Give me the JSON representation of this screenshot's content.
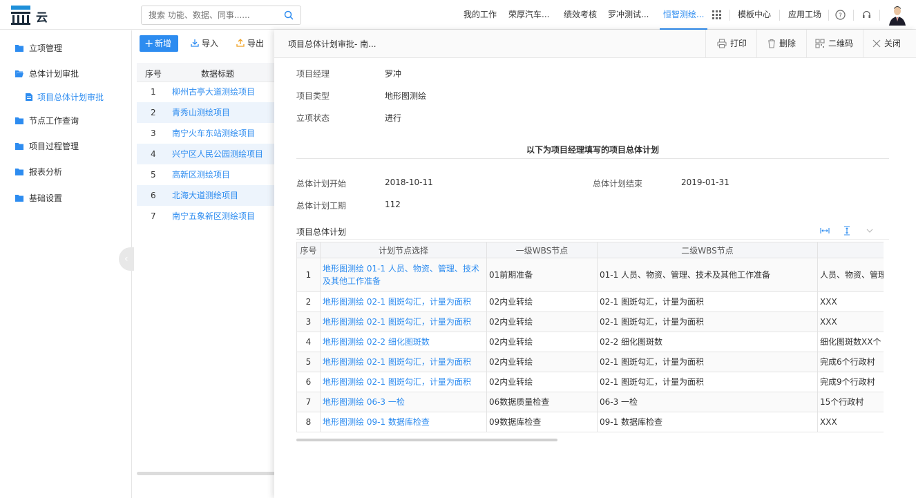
{
  "app": {
    "logo_text": "云"
  },
  "search": {
    "placeholder": "搜索 功能、数据、同事......"
  },
  "topnav": {
    "items": [
      "我的工作",
      "荣厚汽车...",
      "绩效考核",
      "罗冲测试...",
      "恒智测绘...",
      "模板中心",
      "应用工场"
    ]
  },
  "sidebar": {
    "items": [
      "立项管理",
      "总体计划审批",
      "项目总体计划审批",
      "节点工作查询",
      "项目过程管理",
      "报表分析",
      "基础设置"
    ]
  },
  "toolbar": {
    "add": "新增",
    "import": "导入",
    "export": "导出"
  },
  "list": {
    "headers": [
      "序号",
      "数据标题"
    ],
    "rows": [
      {
        "idx": "1",
        "title": "柳州古亭大道测绘项目"
      },
      {
        "idx": "2",
        "title": "青秀山测绘项目"
      },
      {
        "idx": "3",
        "title": "南宁火车东站测绘项目"
      },
      {
        "idx": "4",
        "title": "兴宁区人民公园测绘项目"
      },
      {
        "idx": "5",
        "title": "高新区测绘项目"
      },
      {
        "idx": "6",
        "title": "北海大道测绘项目"
      },
      {
        "idx": "7",
        "title": "南宁五象新区测绘项目"
      }
    ]
  },
  "panel": {
    "title": "项目总体计划审批- 南...",
    "buttons": {
      "print": "打印",
      "delete": "删除",
      "qrcode": "二维码",
      "close": "关闭"
    },
    "fields": {
      "manager_label": "项目经理",
      "manager_value": "罗冲",
      "type_label": "项目类型",
      "type_value": "地形图测绘",
      "status_label": "立项状态",
      "status_value": "进行"
    },
    "section_title": "以下为项目经理填写的项目总体计划",
    "plan": {
      "start_label": "总体计划开始",
      "start_value": "2018-10-11",
      "end_label": "总体计划结束",
      "end_value": "2019-01-31",
      "period_label": "总体计划工期",
      "period_value": "112"
    },
    "table_label": "项目总体计划",
    "table": {
      "headers": [
        "序号",
        "计划节点选择",
        "一级WBS节点",
        "二级WBS节点",
        ""
      ],
      "rows": [
        {
          "idx": "1",
          "node": "地形图测绘 01-1 人员、物资、管理、技术及其他工作准备",
          "wbs1": "01前期准备",
          "wbs2": "01-1 人员、物资、管理、技术及其他工作准备",
          "extra": "人员、物资、管理"
        },
        {
          "idx": "2",
          "node": "地形图测绘 02-1 图斑勾汇，计量为面积",
          "wbs1": "02内业转绘",
          "wbs2": "02-1 图斑勾汇，计量为面积",
          "extra": "XXX"
        },
        {
          "idx": "3",
          "node": "地形图测绘 02-1 图斑勾汇，计量为面积",
          "wbs1": "02内业转绘",
          "wbs2": "02-1 图斑勾汇，计量为面积",
          "extra": "XXX"
        },
        {
          "idx": "4",
          "node": "地形图测绘 02-2 细化图斑数",
          "wbs1": "02内业转绘",
          "wbs2": "02-2 细化图斑数",
          "extra": "细化图斑数XX个"
        },
        {
          "idx": "5",
          "node": "地形图测绘 02-1 图斑勾汇，计量为面积",
          "wbs1": "02内业转绘",
          "wbs2": "02-1 图斑勾汇，计量为面积",
          "extra": "完成6个行政村"
        },
        {
          "idx": "6",
          "node": "地形图测绘 02-1 图斑勾汇，计量为面积",
          "wbs1": "02内业转绘",
          "wbs2": "02-1 图斑勾汇，计量为面积",
          "extra": "完成9个行政村"
        },
        {
          "idx": "7",
          "node": "地形图测绘 06-3 一检",
          "wbs1": "06数据质量检查",
          "wbs2": "06-3 一检",
          "extra": "15个行政村"
        },
        {
          "idx": "8",
          "node": "地形图测绘 09-1 数据库检查",
          "wbs1": "09数据库检查",
          "wbs2": "09-1 数据库检查",
          "extra": "XXX"
        }
      ]
    }
  }
}
